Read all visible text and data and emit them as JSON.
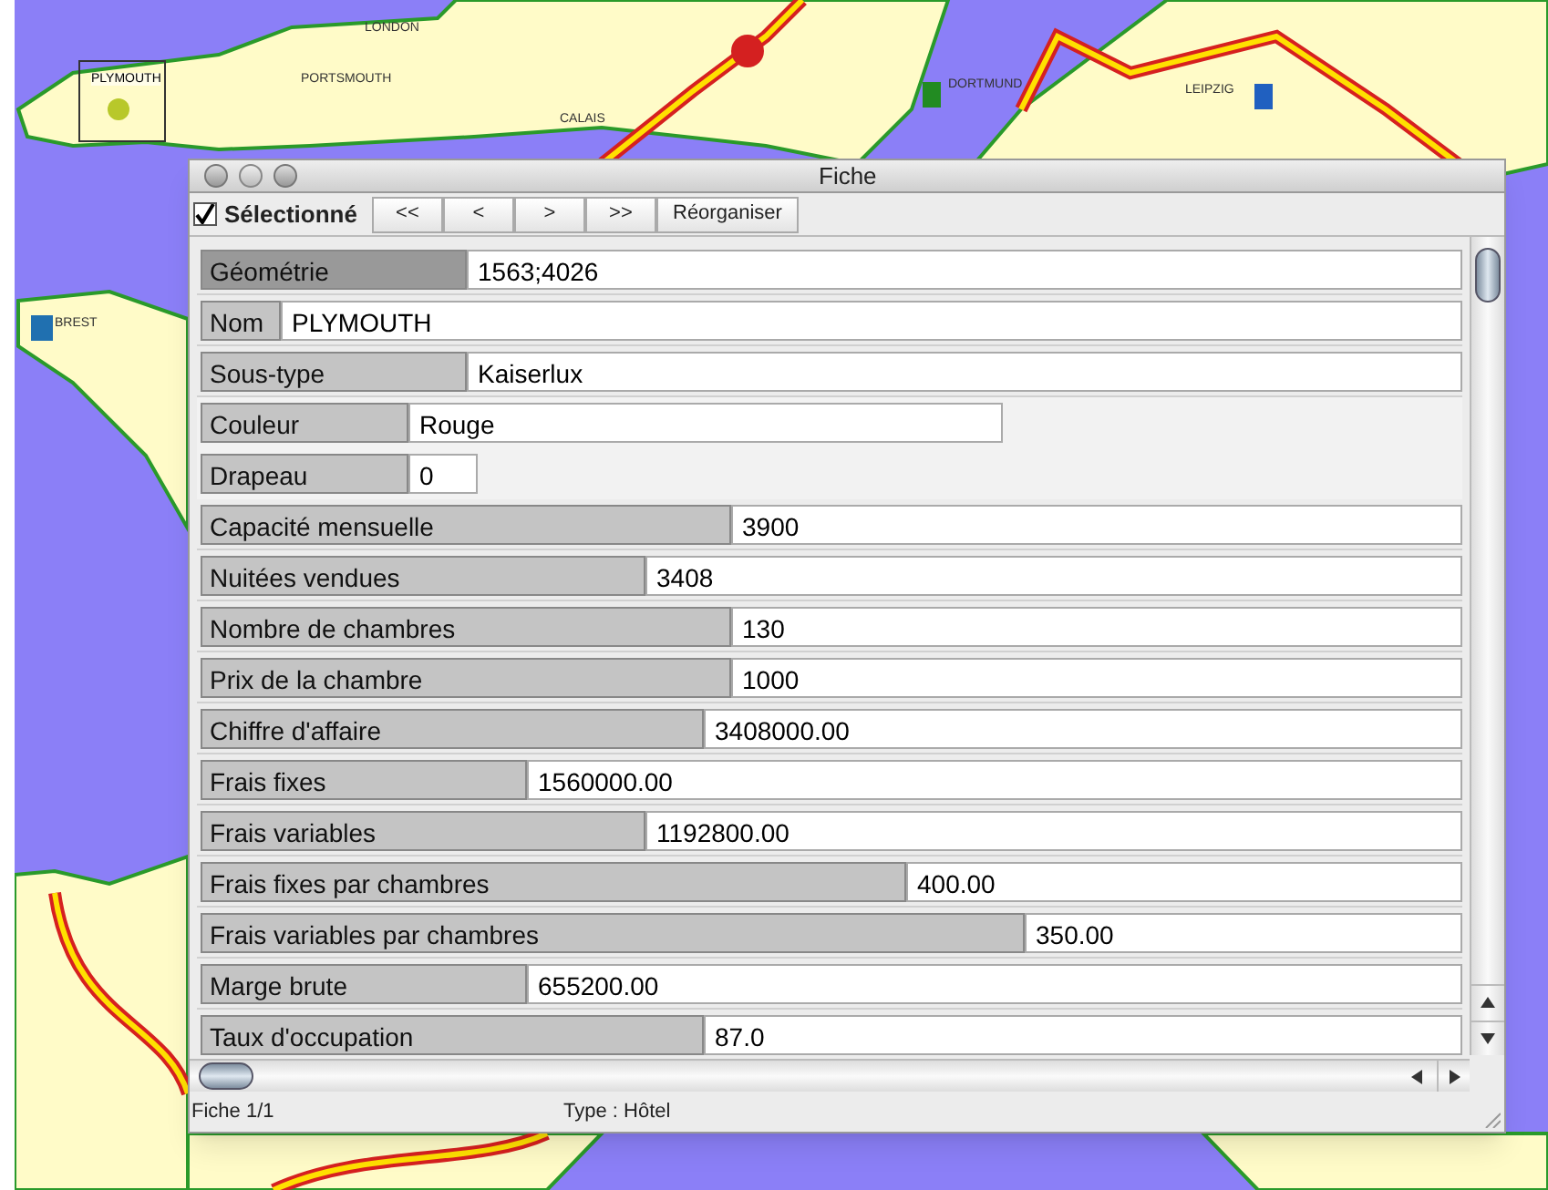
{
  "map": {
    "kind": "picture",
    "cities": [
      {
        "label": "LONDON",
        "selected": false
      },
      {
        "label": "PLYMOUTH",
        "selected": true
      },
      {
        "label": "PORTSMOUTH",
        "selected": false
      },
      {
        "label": "CALAIS",
        "selected": false
      },
      {
        "label": "DORTMUND",
        "selected": false
      },
      {
        "label": "LEIPZIG",
        "selected": false
      },
      {
        "label": "BREST",
        "selected": false
      }
    ]
  },
  "window": {
    "title": "Fiche",
    "toolbar": {
      "checkbox": {
        "label": "Sélectionné",
        "checked": true
      },
      "buttons": [
        "<<",
        "<",
        ">",
        ">>",
        "Réorganiser"
      ]
    },
    "fields": [
      {
        "label": "Géométrie",
        "value": "1563;4026",
        "selected": true
      },
      {
        "label": "Nom",
        "value": "PLYMOUTH",
        "selected": false
      },
      {
        "label": "Sous-type",
        "value": "Kaiserlux",
        "selected": false
      },
      {
        "label": "Couleur",
        "value": "Rouge",
        "selected": false
      },
      {
        "label": "Drapeau",
        "value": "0",
        "selected": false
      },
      {
        "label": "Capacité mensuelle",
        "value": "3900",
        "selected": false
      },
      {
        "label": "Nuitées vendues",
        "value": "3408",
        "selected": false
      },
      {
        "label": "Nombre de chambres",
        "value": "130",
        "selected": false
      },
      {
        "label": "Prix de la chambre",
        "value": "1000",
        "selected": false
      },
      {
        "label": "Chiffre d'affaire",
        "value": "3408000.00",
        "selected": false
      },
      {
        "label": "Frais fixes",
        "value": "1560000.00",
        "selected": false
      },
      {
        "label": "Frais variables",
        "value": "1192800.00",
        "selected": false
      },
      {
        "label": "Frais fixes par chambres",
        "value": "400.00",
        "selected": false
      },
      {
        "label": "Frais variables par chambres",
        "value": "350.00",
        "selected": false
      },
      {
        "label": "Marge brute",
        "value": "655200.00",
        "selected": false
      },
      {
        "label": "Taux d'occupation",
        "value": "87.0",
        "selected": false
      }
    ],
    "status_bar": {
      "record": "Fiche 1/1",
      "type": "Type : Hôtel"
    }
  }
}
